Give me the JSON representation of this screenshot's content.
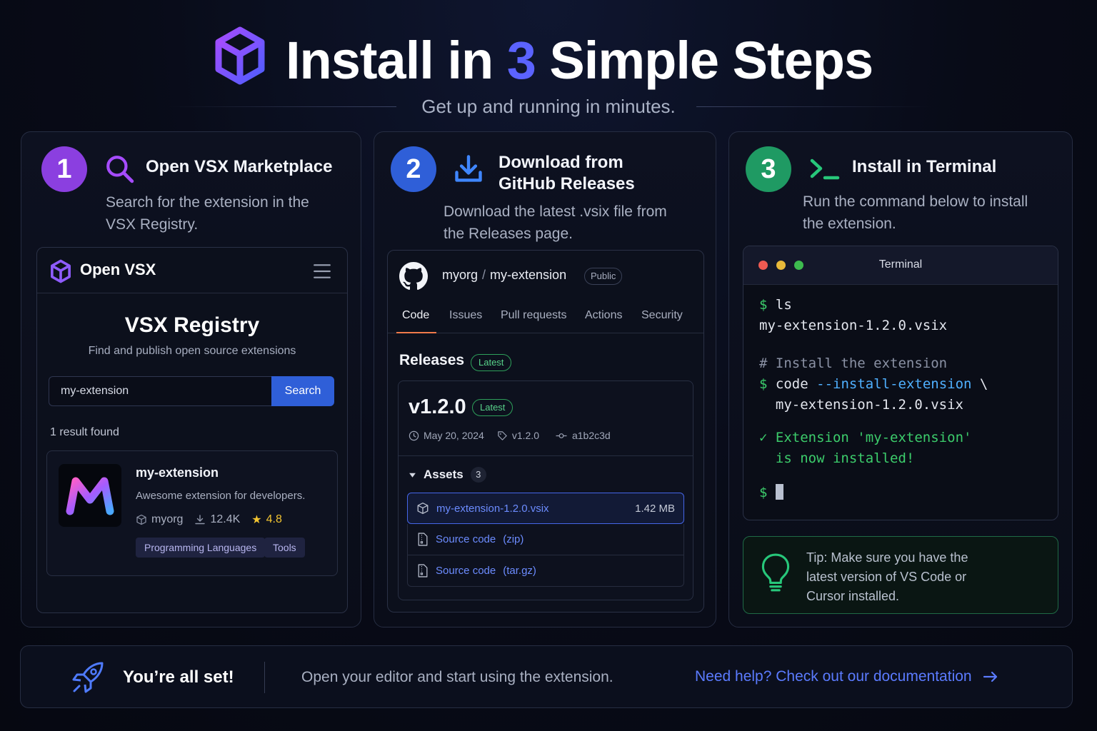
{
  "header": {
    "title_pre": "Install in ",
    "title_num": "3",
    "title_post": " Simple Steps",
    "subtitle": "Get up and running in minutes."
  },
  "steps": [
    {
      "number": "1",
      "title": "Open VSX Marketplace",
      "desc_line1": "Search for the extension in the",
      "desc_line2": "VSX Registry.",
      "icon": "search-icon",
      "color": "#8b3fe0"
    },
    {
      "number": "2",
      "title_line1": "Download from",
      "title_line2": "GitHub Releases",
      "desc_line1": "Download the latest .vsix file from",
      "desc_line2": "the Releases page.",
      "icon": "download-icon",
      "color": "#2f5fd8"
    },
    {
      "number": "3",
      "title": "Install in Terminal",
      "desc_line1": "Run the command below to install",
      "desc_line2": "the extension.",
      "icon": "terminal-prompt-icon",
      "color": "#1f9a63"
    }
  ],
  "openvsx": {
    "brand": "Open VSX",
    "heading": "VSX Registry",
    "subheading": "Find and publish open source extensions",
    "search_value": "my-extension",
    "search_button": "Search",
    "result_count": "1 result found",
    "result": {
      "name": "my-extension",
      "description": "Awesome extension for developers.",
      "publisher": "myorg",
      "downloads": "12.4K",
      "rating": "4.8",
      "tags": [
        "Programming Languages",
        "Tools"
      ]
    }
  },
  "github": {
    "owner": "myorg",
    "repo": "my-extension",
    "visibility": "Public",
    "tabs": [
      "Code",
      "Issues",
      "Pull requests",
      "Actions",
      "Security"
    ],
    "active_tab": "Code",
    "releases_label": "Releases",
    "latest_label": "Latest",
    "release": {
      "version": "v1.2.0",
      "latest": "Latest",
      "date": "May 20, 2024",
      "tag": "v1.2.0",
      "commit": "a1b2c3d",
      "assets_label": "Assets",
      "assets_count": "3",
      "assets": [
        {
          "name": "my-extension-1.2.0.vsix",
          "size": "1.42 MB"
        },
        {
          "name": "Source code",
          "suffix": "(zip)"
        },
        {
          "name": "Source code",
          "suffix": "(tar.gz)"
        }
      ]
    }
  },
  "terminal": {
    "title": "Terminal",
    "prompt": "$",
    "cmd1": "ls",
    "out1": "my-extension-1.2.0.vsix",
    "comment": "# Install the extension",
    "cmd2_bin": "code",
    "cmd2_flag": "--install-extension",
    "cmd2_cont": "\\",
    "cmd2_arg": "my-extension-1.2.0.vsix",
    "check": "✓",
    "success_line1": "Extension 'my-extension'",
    "success_line2": "is now installed!"
  },
  "tip": {
    "text": "Tip: Make sure you have the latest version of VS Code or Cursor installed."
  },
  "footer": {
    "title": "You’re all set!",
    "description": "Open your editor and start using the extension.",
    "link": "Need help? Check out our documentation"
  },
  "colors": {
    "accent": "#5b63ff",
    "purple": "#8b3fe0",
    "blue": "#2f5fd8",
    "green": "#1f9a63",
    "link": "#5b7bff"
  }
}
